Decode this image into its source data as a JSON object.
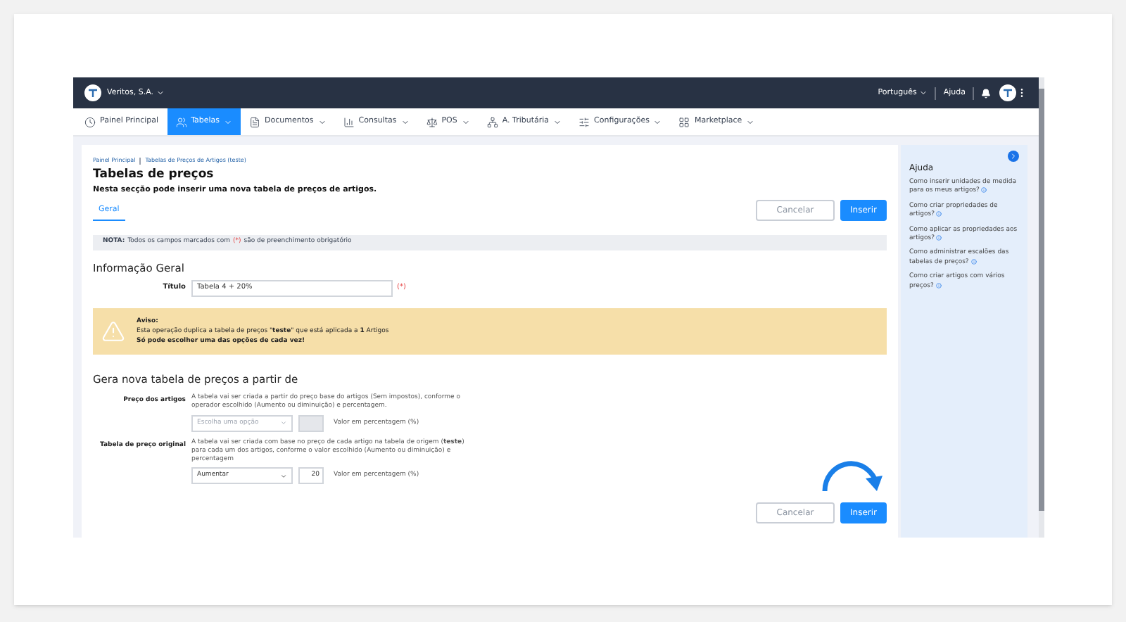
{
  "top_bar": {
    "company": "Veritos, S.A.",
    "language": "Português",
    "help": "Ajuda"
  },
  "nav": [
    {
      "label": "Painel Principal",
      "dropdown": false,
      "selected": false
    },
    {
      "label": "Tabelas",
      "dropdown": true,
      "selected": true
    },
    {
      "label": "Documentos",
      "dropdown": true,
      "selected": false
    },
    {
      "label": "Consultas",
      "dropdown": true,
      "selected": false
    },
    {
      "label": "POS",
      "dropdown": true,
      "selected": false
    },
    {
      "label": "A. Tributária",
      "dropdown": true,
      "selected": false
    },
    {
      "label": "Configurações",
      "dropdown": true,
      "selected": false
    },
    {
      "label": "Marketplace",
      "dropdown": true,
      "selected": false
    }
  ],
  "breadcrumb": [
    "Painel Principal",
    "Tabelas de Preços de Artigos (teste)"
  ],
  "page": {
    "title": "Tabelas de preços",
    "subtitle": "Nesta secção pode inserir uma nova tabela de preços de artigos."
  },
  "tabs": [
    {
      "label": "Geral",
      "selected": true
    }
  ],
  "buttons": {
    "cancel": "Cancelar",
    "submit": "Inserir"
  },
  "note": {
    "label": "NOTA:",
    "before": "Todos os campos marcados com",
    "mark": "(*)",
    "after": "são de preenchimento obrigatório"
  },
  "info_section": {
    "heading": "Informação Geral",
    "field_label": "Título",
    "value": "Tabela 4 + 20%",
    "required_mark": "(*)"
  },
  "warning": {
    "title": "Aviso:",
    "line1": "Esta operação duplica a tabela de preços \"**teste**\" que está aplicada a **1** Artigos",
    "line2": "Só pode escolher uma das opções de cada vez!"
  },
  "generate": {
    "heading": "Gera nova tabela de preços a partir de",
    "options": [
      {
        "label": "Preço dos artigos",
        "description": "A tabela vai ser criada a partir do preço base do artigos (Sem impostos), conforme o operador escolhido (Aumento ou diminuição) e percentagem.",
        "select": "Escolha uma opção",
        "unit": "Valor em percentagem (%)",
        "disabled": true
      },
      {
        "label": "Tabela de preço original",
        "description": "A tabela vai ser criada com base no preço de cada artigo na tabela de origem (**teste**) para cada um dos artigos, conforme o valor escolhido (Aumento ou diminuição) e percentagem",
        "select": "Aumentar",
        "value": "20",
        "unit": "Valor em percentagem (%)",
        "disabled": false
      }
    ]
  },
  "footer_buttons": {
    "cancel": "Cancelar",
    "submit": "Inserir"
  },
  "help": {
    "title": "Ajuda",
    "items": [
      "Como inserir unidades de medida para os meus artigos?",
      "Como criar propriedades de artigos?",
      "Como aplicar as propriedades aos artigos?",
      "Como administrar escalões das tabelas de preços?",
      "Como criar artigos com vários preços?"
    ]
  }
}
